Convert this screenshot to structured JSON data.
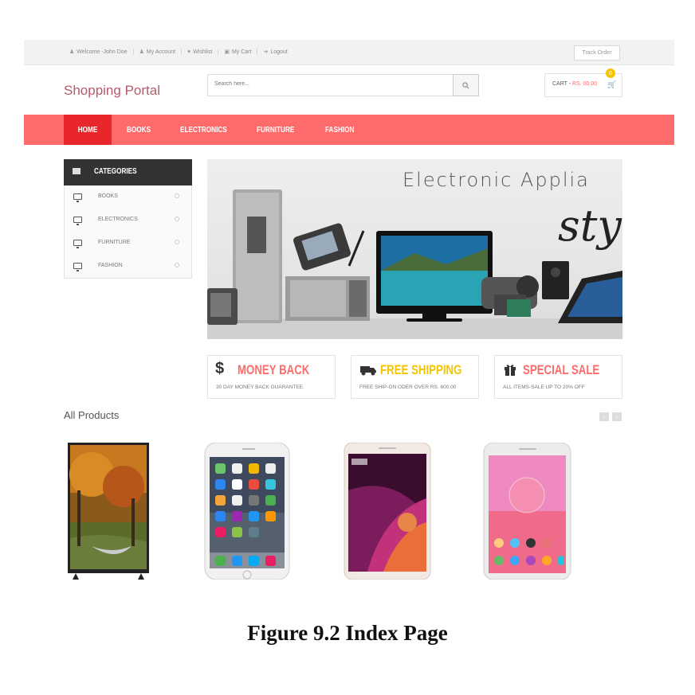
{
  "top_bar": {
    "links": [
      {
        "icon": "user-icon",
        "label": "Welcome -John Doe"
      },
      {
        "icon": "user-icon",
        "label": "My Account"
      },
      {
        "icon": "heart-icon",
        "label": "Wishlist"
      },
      {
        "icon": "cart-icon",
        "label": "My Cart"
      },
      {
        "icon": "logout-icon",
        "label": "Logout"
      }
    ],
    "track_order": "Track Order"
  },
  "header": {
    "logo": "Shopping Portal",
    "search_placeholder": "Search here...",
    "cart_label": "CART -",
    "cart_amount": "RS. 00.00",
    "cart_count": "0"
  },
  "nav": {
    "items": [
      "HOME",
      "BOOKS",
      "ELECTRONICS",
      "FURNITURE",
      "FASHION"
    ],
    "active": "HOME"
  },
  "categories": {
    "title": "CATEGORIES",
    "items": [
      "BOOKS",
      "ELECTRONICS",
      "FURNITURE",
      "FASHION"
    ]
  },
  "banner": {
    "title": "Electronic Applia",
    "script_text": "sty"
  },
  "features": [
    {
      "icon": "dollar-icon",
      "title": "MONEY BACK",
      "subtitle": "30 DAY MONEY BACK GUARANTEE."
    },
    {
      "icon": "truck-icon",
      "title": "FREE SHIPPING",
      "subtitle": "FREE SHIP-ON ODER OVER RS. 600.00"
    },
    {
      "icon": "gift-icon",
      "title": "SPECIAL SALE",
      "subtitle": "ALL ITEMS-SALE UP TO 20% OFF"
    }
  ],
  "products": {
    "title": "All Products",
    "items": [
      {
        "image": "tv-autumn-product"
      },
      {
        "image": "iphone-product"
      },
      {
        "image": "redmi-product"
      },
      {
        "image": "lenovo-product"
      }
    ]
  },
  "caption": "Figure 9.2 Index Page",
  "colors": {
    "accent": "#ff6b6b",
    "active_nav": "#e8262b",
    "logo": "#b45a6a",
    "dark": "#333333"
  }
}
